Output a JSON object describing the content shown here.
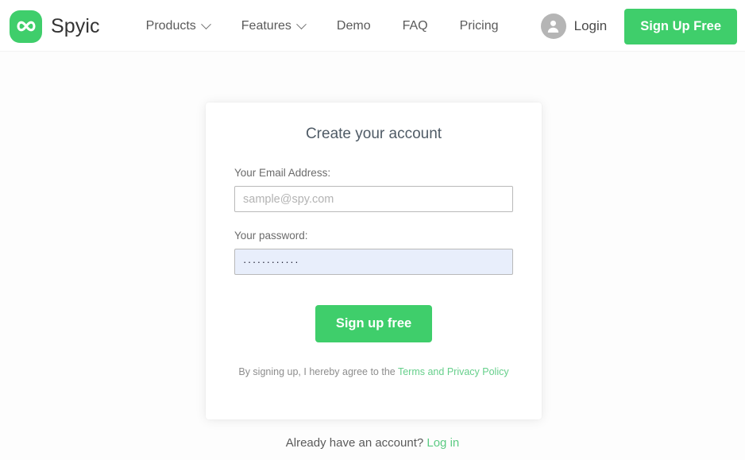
{
  "brand": {
    "name": "Spyic",
    "logo_icon": "infinity-icon",
    "logo_color": "#3fce6b"
  },
  "navbar": {
    "links": [
      {
        "label": "Products",
        "has_caret": true,
        "icon": "chevron-down-icon"
      },
      {
        "label": "Features",
        "has_caret": true,
        "icon": "chevron-down-icon"
      },
      {
        "label": "Demo",
        "has_caret": false
      },
      {
        "label": "FAQ",
        "has_caret": false
      },
      {
        "label": "Pricing",
        "has_caret": false
      }
    ],
    "login": {
      "label": "Login",
      "icon": "user-avatar-icon",
      "icon_bg": "#b5b5b5"
    },
    "signup_button": {
      "label": "Sign Up Free",
      "color": "#3fce6b"
    }
  },
  "signup_card": {
    "title": "Create your account",
    "email": {
      "label": "Your Email Address:",
      "placeholder": "sample@spy.com",
      "value": ""
    },
    "password": {
      "label": "Your password:",
      "placeholder": "",
      "value": "············",
      "field_background": "#e8eefb"
    },
    "submit_button": {
      "label": "Sign up free",
      "color": "#3fce6b"
    },
    "terms": {
      "text": "By signing up, I hereby agree to the",
      "link": "Terms and Privacy Policy",
      "link_color": "#66cf8b"
    }
  },
  "footer": {
    "prompt": "Already have an account?",
    "link": "Log in",
    "link_color": "#5ccb83"
  }
}
